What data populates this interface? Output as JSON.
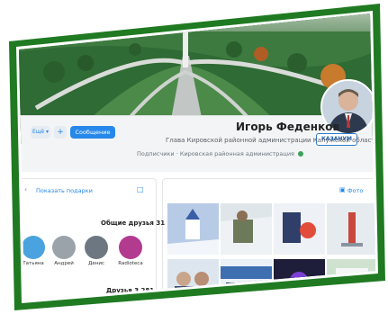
{
  "profile": {
    "name": "Игорь Феденков",
    "subtitle": "Глава Кировской районной администрации Калужской области",
    "organization": "Кировская районная администрация",
    "followers": "Подписчики",
    "logo_text": "КАЗАНУМ"
  },
  "actions": {
    "message_label": "Сообщение",
    "add_friend_icon": "add-friend-icon",
    "more_label": "Ещё"
  },
  "left": {
    "gift_link": "Показать подарки",
    "common_friends_title": "Общие друзья 31",
    "friends_title": "Друзья 3 281",
    "common_friends": [
      {
        "name": "Татьяна",
        "color": "#4aa3df"
      },
      {
        "name": "Андрей",
        "color": "#9aa2aa"
      },
      {
        "name": "Денис",
        "color": "#6d7782"
      },
      {
        "name": "Radioteca",
        "color": "#b23b8f"
      }
    ]
  },
  "photos": {
    "label": "Фото",
    "colors": [
      "#b9c7dc",
      "#8ba38a",
      "#cfd7e3",
      "#9aa8b8",
      "#e8eef5",
      "#7f8f7d",
      "#20213a",
      "#7ebfd6"
    ]
  },
  "palette": {
    "accent": "#2688eb",
    "frame": "#1f7a22"
  }
}
